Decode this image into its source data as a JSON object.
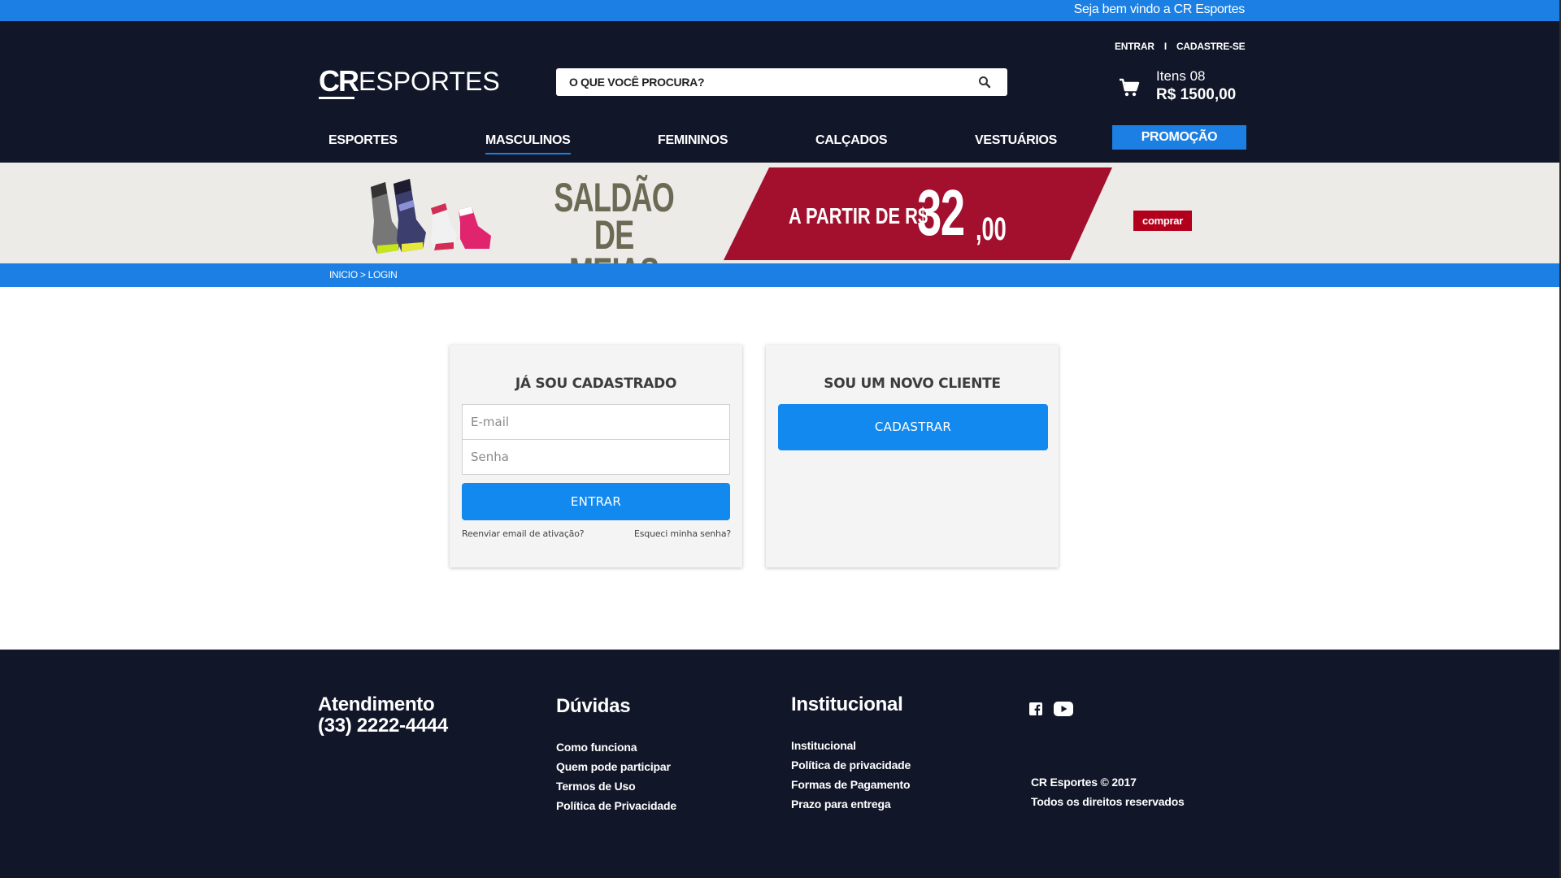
{
  "topbar": {
    "welcome": "Seja bem vindo a CR Esportes"
  },
  "header": {
    "auth": {
      "login": "ENTRAR",
      "separator": "I",
      "signup": "CADASTRE-SE"
    },
    "logo": {
      "bold": "CR",
      "light": "ESPORTES"
    },
    "search": {
      "placeholder": "O QUE VOCÊ PROCURA?",
      "icon": "search-icon"
    },
    "cart": {
      "icon": "cart-icon",
      "items": "Itens 08",
      "total": "R$ 1500,00"
    }
  },
  "nav": {
    "items": [
      {
        "label": "ESPORTES"
      },
      {
        "label": "MASCULINOS",
        "active": true
      },
      {
        "label": "FEMININOS"
      },
      {
        "label": "CALÇADOS"
      },
      {
        "label": "VESTUÁRIOS"
      }
    ],
    "promo": "PROMOÇÃO"
  },
  "banner": {
    "headline_1": "SALDÃO",
    "headline_2": "DE MEIAS",
    "from_label": "A PARTIR DE R$",
    "price_int": "32",
    "price_cents": ",00",
    "cta": "comprar",
    "colors": {
      "background": "#ecebe7",
      "red": "#a3102e",
      "cta": "#b2001c"
    }
  },
  "breadcrumb": "INICIO > LOGIN",
  "login": {
    "title": "JÁ SOU CADASTRADO",
    "email_placeholder": "E-mail",
    "password_placeholder": "Senha",
    "submit": "ENTRAR",
    "resend_link": "Reenviar email de ativação?",
    "forgot_link": "Esqueci minha senha?"
  },
  "register": {
    "title": "SOU UM NOVO CLIENTE",
    "button": "CADASTRAR"
  },
  "footer": {
    "contact": {
      "title": "Atendimento",
      "phone": "(33) 2222-4444"
    },
    "faq": {
      "title": "Dúvidas",
      "links": [
        "Como funciona",
        "Quem pode participar",
        "Termos de Uso",
        "Política de Privacidade"
      ]
    },
    "institutional": {
      "title": "Institucional",
      "links": [
        "Institucional",
        "Política de privacidade",
        "Formas de Pagamento",
        "Prazo para entrega"
      ]
    },
    "social": [
      "facebook-icon",
      "youtube-icon"
    ],
    "copyright_1": "CR Esportes © 2017",
    "copyright_2": "Todos os direitos reservados"
  },
  "colors": {
    "accent": "#1b7fe3",
    "dark": "#121629",
    "button": "#1189ee"
  }
}
